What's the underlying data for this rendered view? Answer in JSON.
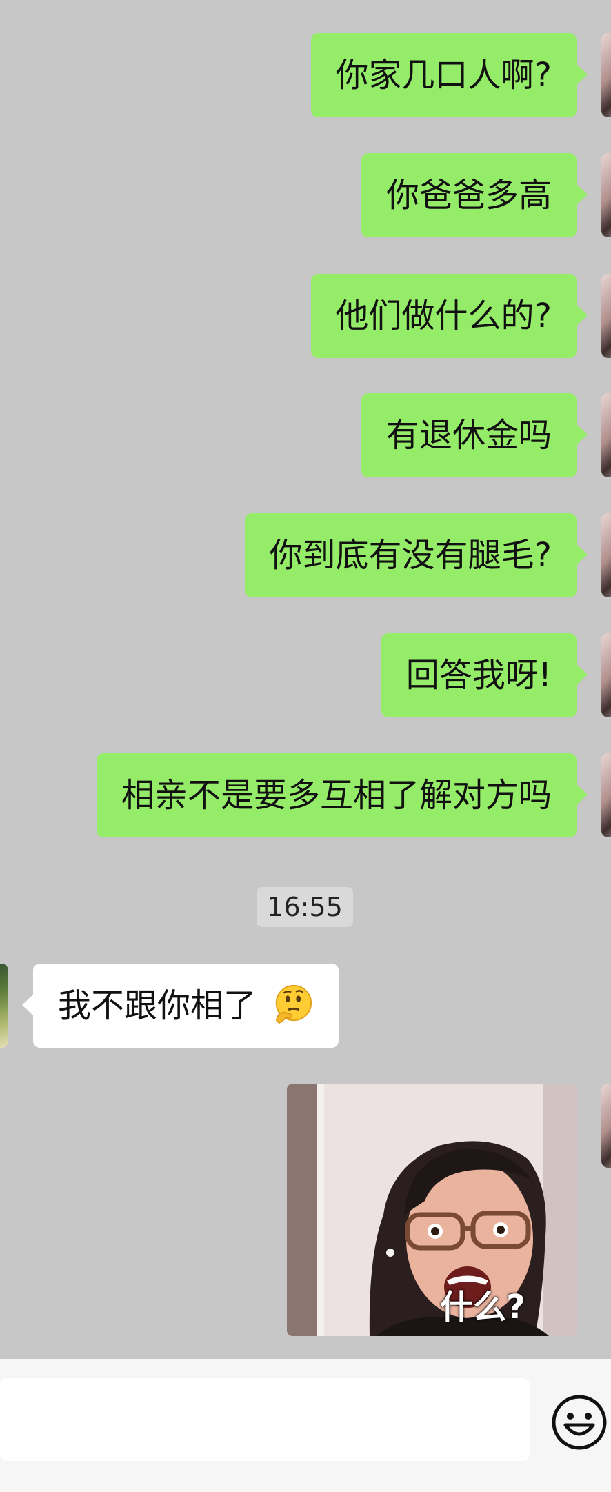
{
  "messages": [
    {
      "side": "right",
      "text": "你家几口人啊?"
    },
    {
      "side": "right",
      "text": "你爸爸多高"
    },
    {
      "side": "right",
      "text": "他们做什么的?"
    },
    {
      "side": "right",
      "text": "有退休金吗"
    },
    {
      "side": "right",
      "text": "你到底有没有腿毛?"
    },
    {
      "side": "right",
      "text": "回答我呀!"
    },
    {
      "side": "right",
      "text": "相亲不是要多互相了解对方吗"
    }
  ],
  "timestamp": "16:55",
  "reply": {
    "side": "left",
    "text": "我不跟你相了",
    "emoji": "thinking-face-icon"
  },
  "sticker": {
    "caption": "什么?"
  },
  "input_bar": {
    "placeholder": "",
    "emoji_button": "smiley-icon"
  },
  "colors": {
    "sent_bubble": "#95ec69",
    "received_bubble": "#ffffff",
    "chat_background": "#c7c7c7"
  }
}
